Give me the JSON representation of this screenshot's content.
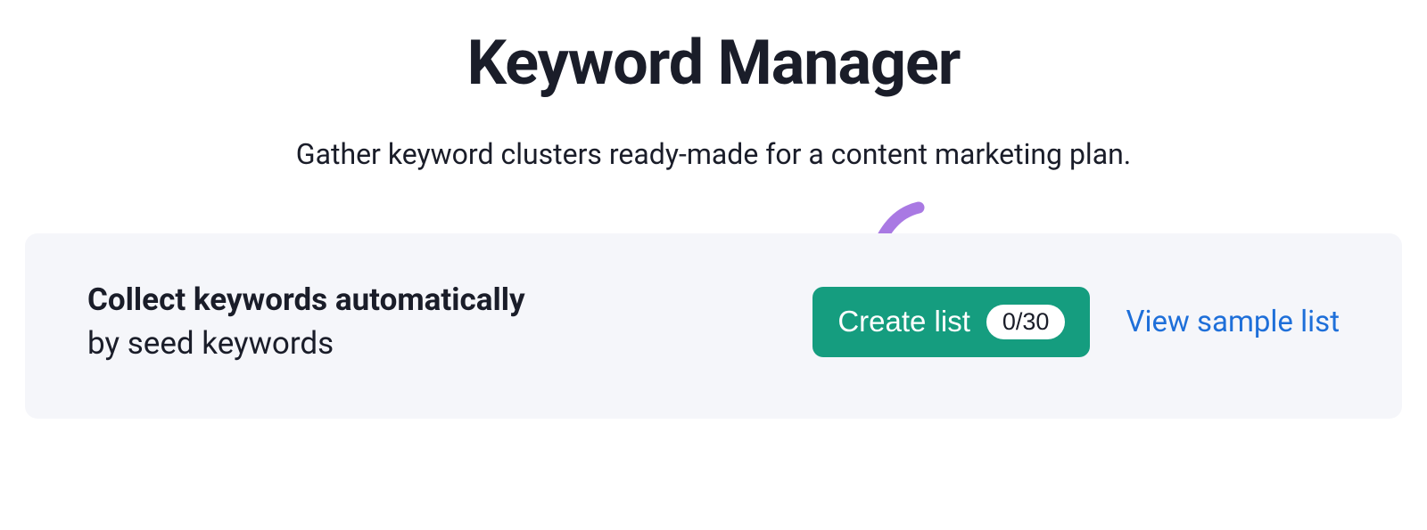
{
  "header": {
    "title": "Keyword Manager",
    "subtitle": "Gather keyword clusters ready-made for a content marketing plan."
  },
  "panel": {
    "title": "Collect keywords automatically",
    "subtitle": "by seed keywords",
    "create_button_label": "Create list",
    "count_badge": "0/30",
    "view_sample_label": "View sample list"
  },
  "colors": {
    "accent_green": "#159d7f",
    "link_blue": "#1e6fd9",
    "annotation_purple": "#a979e3",
    "panel_bg": "#f5f6fa",
    "text_primary": "#1a1d29"
  }
}
